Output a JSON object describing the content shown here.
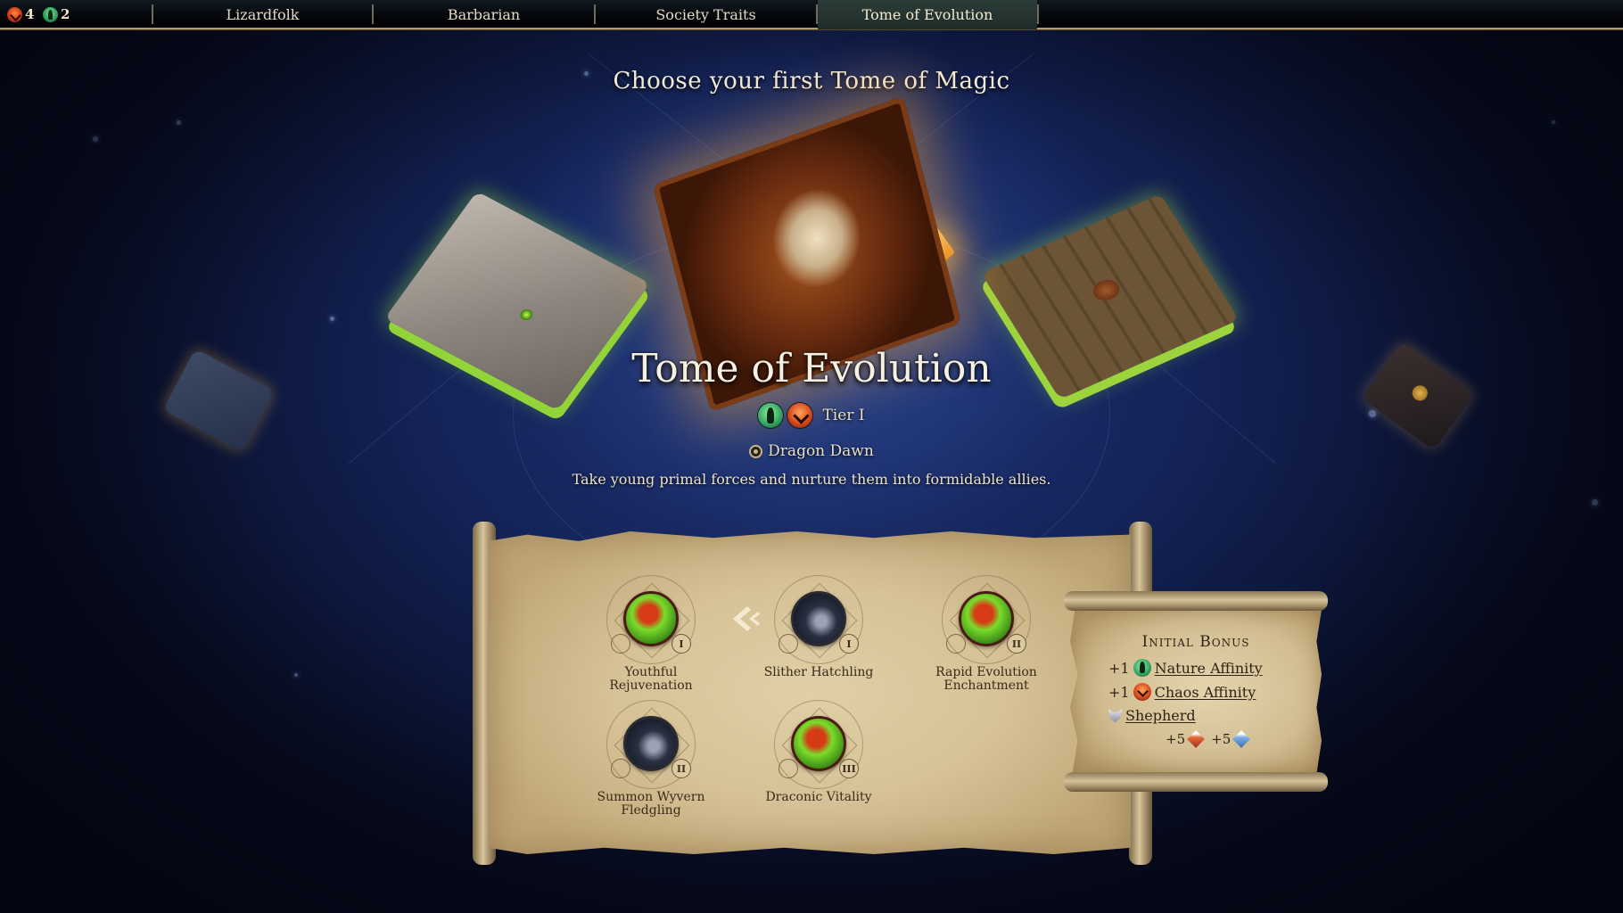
{
  "topbar": {
    "resources": [
      {
        "icon": "chaos-affinity-icon",
        "value": "4"
      },
      {
        "icon": "nature-affinity-icon",
        "value": "2"
      }
    ],
    "tabs": [
      {
        "label": "Lizardfolk",
        "active": false
      },
      {
        "label": "Barbarian",
        "active": false
      },
      {
        "label": "Society Traits",
        "active": false
      },
      {
        "label": "Tome of Evolution",
        "active": true
      }
    ]
  },
  "header": {
    "title": "Choose your first Tome of Magic"
  },
  "books": [
    {
      "name": "far-left-tome",
      "position": "far-left"
    },
    {
      "name": "left-tome",
      "position": "left"
    },
    {
      "name": "tome-of-evolution",
      "position": "center",
      "selected": true
    },
    {
      "name": "right-tome",
      "position": "right"
    },
    {
      "name": "far-right-tome",
      "position": "far-right"
    }
  ],
  "tome": {
    "title": "Tome of Evolution",
    "affinities": [
      "nature-affinity-icon",
      "chaos-affinity-icon"
    ],
    "tier": "Tier I",
    "realm_icon": "dragon-dawn-icon",
    "realm": "Dragon Dawn",
    "description": "Take young primal forces and nurture them into formidable allies."
  },
  "spells": [
    {
      "label": "Youthful Rejuvenation",
      "tier": "I",
      "art": "green"
    },
    {
      "label": "Slither Hatchling",
      "tier": "I",
      "art": "dark"
    },
    {
      "label": "Rapid Evolution Enchantment",
      "tier": "II",
      "art": "green"
    },
    {
      "label": "Summon Wyvern Fledgling",
      "tier": "II",
      "art": "dark"
    },
    {
      "label": "Draconic Vitality",
      "tier": "III",
      "art": "green"
    }
  ],
  "initial_bonus": {
    "title": "Initial Bonus",
    "lines": [
      {
        "prefix": "+1",
        "icon": "nature-affinity-icon",
        "label": "Nature Affinity"
      },
      {
        "prefix": "+1",
        "icon": "chaos-affinity-icon",
        "label": "Chaos Affinity"
      },
      {
        "prefix": "",
        "icon": "wolf-icon",
        "label": "Shepherd"
      }
    ],
    "resources": [
      {
        "value": "+5",
        "icon": "red-gem-icon"
      },
      {
        "value": "+5",
        "icon": "blue-gem-icon"
      }
    ]
  },
  "colors": {
    "accent_gold": "#b39a68",
    "parchment": "#d6c296",
    "background": "#15245a"
  }
}
